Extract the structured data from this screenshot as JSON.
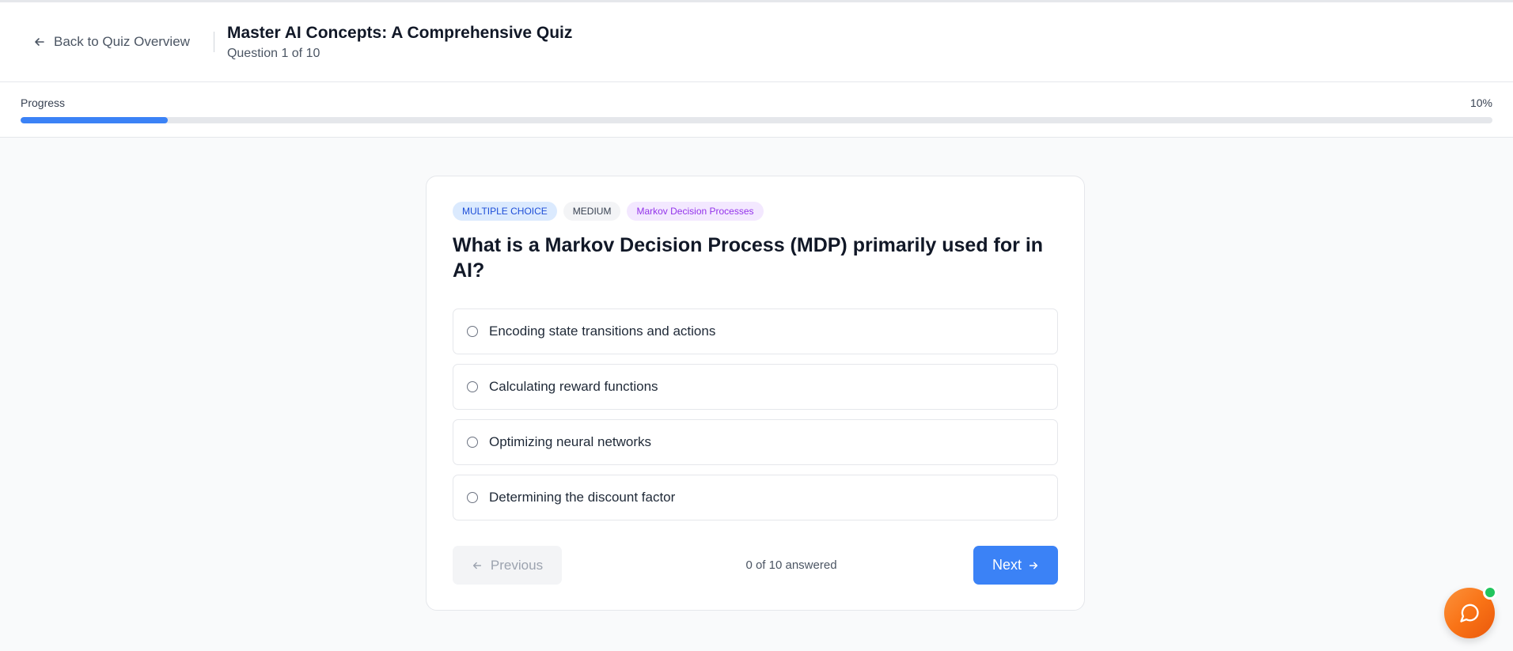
{
  "header": {
    "back_label": "Back to Quiz Overview",
    "title": "Master AI Concepts: A Comprehensive Quiz",
    "subtitle": "Question 1 of 10"
  },
  "progress": {
    "label": "Progress",
    "percent_label": "10%",
    "fraction": 0.1
  },
  "question": {
    "tags": {
      "type": "MULTIPLE CHOICE",
      "difficulty": "MEDIUM",
      "topic": "Markov Decision Processes"
    },
    "text": "What is a Markov Decision Process (MDP) primarily used for in AI?",
    "options": [
      "Encoding state transitions and actions",
      "Calculating reward functions",
      "Optimizing neural networks",
      "Determining the discount factor"
    ]
  },
  "navigation": {
    "previous_label": "Previous",
    "answered_status": "0 of 10 answered",
    "next_label": "Next"
  },
  "chat": {
    "icon": "chat-bubble-icon",
    "status": "online"
  },
  "colors": {
    "accent": "#3b82f6",
    "chat_gradient_start": "#fb923c",
    "chat_gradient_end": "#ea580c",
    "online": "#22c55e"
  }
}
